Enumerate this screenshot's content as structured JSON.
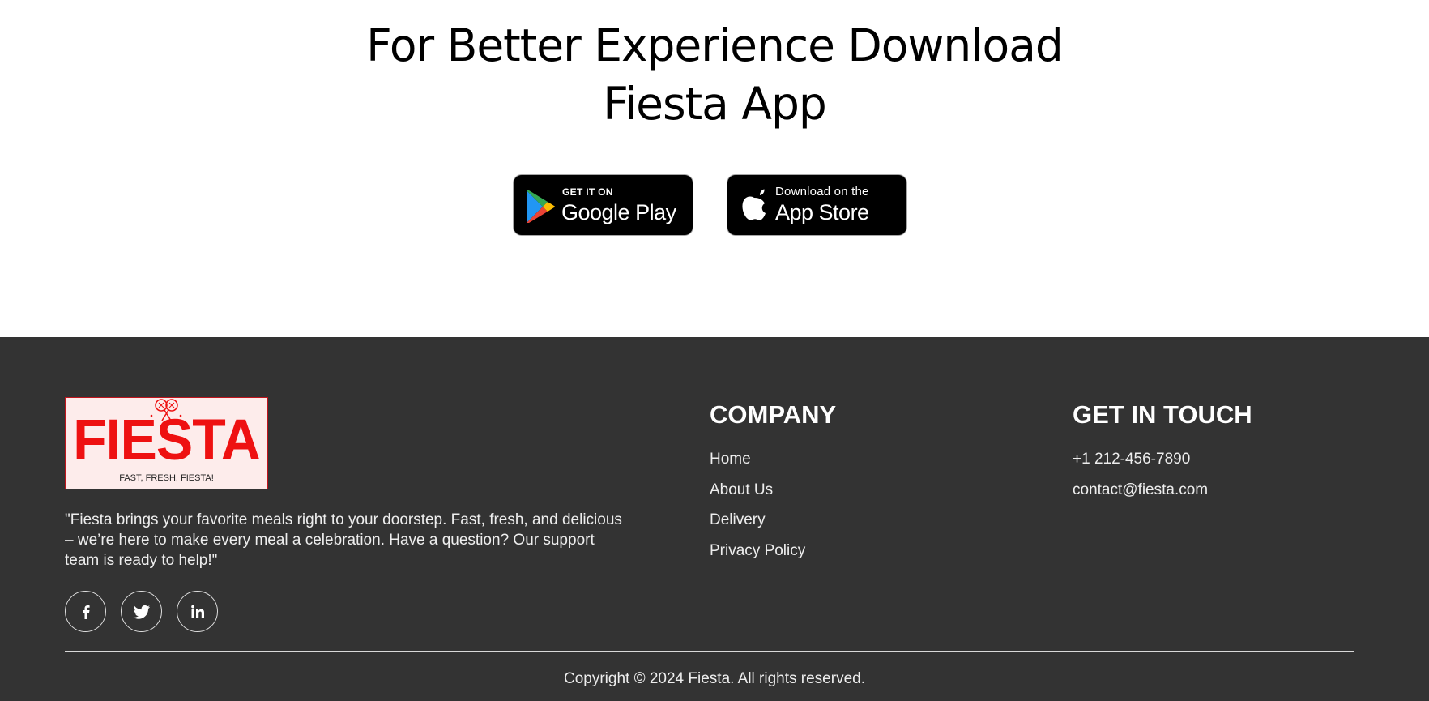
{
  "download": {
    "title_line1": "For Better Experience Download",
    "title_line2": "Fiesta App",
    "google_play": {
      "small": "GET IT ON",
      "large": "Google Play",
      "icon": "google-play-icon"
    },
    "app_store": {
      "small": "Download on the",
      "large": "App Store",
      "icon": "apple-icon"
    }
  },
  "footer": {
    "logo": {
      "text": "FIESTA",
      "tagline": "FAST, FRESH, FIESTA!"
    },
    "about": "\"Fiesta brings your favorite meals right to your doorstep. Fast, fresh, and delicious – we’re here to make every meal a celebration. Have a question? Our support team is ready to help!\"",
    "social": [
      {
        "name": "facebook",
        "icon": "facebook-icon"
      },
      {
        "name": "twitter",
        "icon": "twitter-icon"
      },
      {
        "name": "linkedin",
        "icon": "linkedin-icon"
      }
    ],
    "company": {
      "heading": "COMPANY",
      "links": [
        "Home",
        "About Us",
        "Delivery",
        "Privacy Policy"
      ]
    },
    "contact": {
      "heading": "GET IN TOUCH",
      "phone": "+1 212-456-7890",
      "email": "contact@fiesta.com"
    },
    "copyright": "Copyright © 2024 Fiesta. All rights reserved."
  },
  "colors": {
    "footer_bg": "#333333",
    "logo_red": "#ee1111",
    "logo_bg": "#fdeceb",
    "badge_bg": "#000000"
  }
}
